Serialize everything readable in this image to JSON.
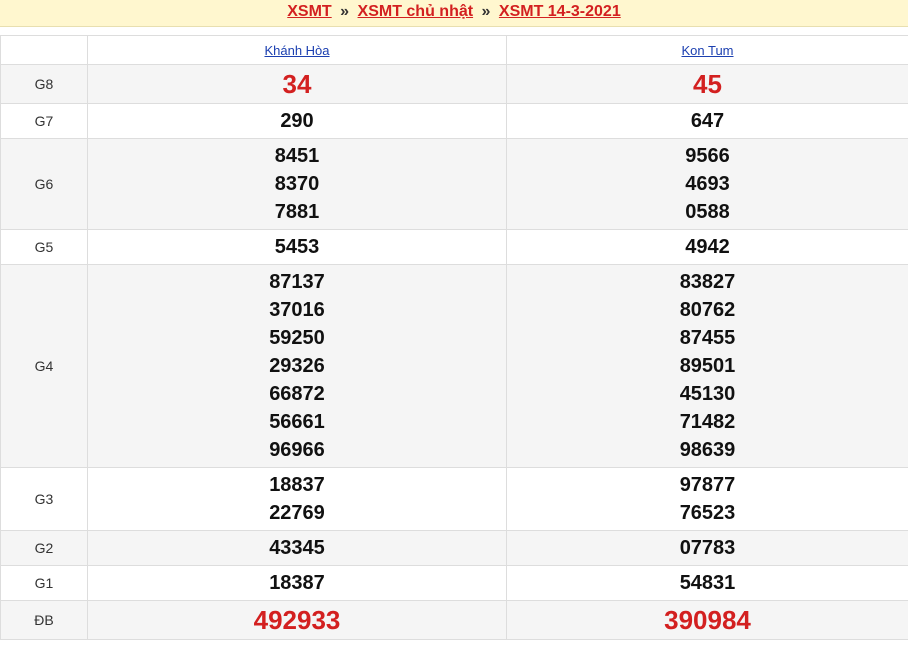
{
  "breadcrumb": {
    "items": [
      "XSMT",
      "XSMT chủ nhật",
      "XSMT 14-3-2021"
    ],
    "separator": "»"
  },
  "table": {
    "columns": [
      "Khánh Hòa",
      "Kon Tum"
    ],
    "rows": [
      {
        "label": "G8",
        "values": [
          [
            "34"
          ],
          [
            "45"
          ]
        ],
        "highlight": true
      },
      {
        "label": "G7",
        "values": [
          [
            "290"
          ],
          [
            "647"
          ]
        ]
      },
      {
        "label": "G6",
        "values": [
          [
            "8451",
            "8370",
            "7881"
          ],
          [
            "9566",
            "4693",
            "0588"
          ]
        ]
      },
      {
        "label": "G5",
        "values": [
          [
            "5453"
          ],
          [
            "4942"
          ]
        ]
      },
      {
        "label": "G4",
        "values": [
          [
            "87137",
            "37016",
            "59250",
            "29326",
            "66872",
            "56661",
            "96966"
          ],
          [
            "83827",
            "80762",
            "87455",
            "89501",
            "45130",
            "71482",
            "98639"
          ]
        ]
      },
      {
        "label": "G3",
        "values": [
          [
            "18837",
            "22769"
          ],
          [
            "97877",
            "76523"
          ]
        ]
      },
      {
        "label": "G2",
        "values": [
          [
            "43345"
          ],
          [
            "07783"
          ]
        ]
      },
      {
        "label": "G1",
        "values": [
          [
            "18387"
          ],
          [
            "54831"
          ]
        ]
      },
      {
        "label": "ĐB",
        "values": [
          [
            "492933"
          ],
          [
            "390984"
          ]
        ],
        "highlight": true
      }
    ]
  },
  "colors": {
    "accent_red": "#d32020",
    "link_blue": "#1b3fb0",
    "breadcrumb_bg": "#fff7cf"
  }
}
